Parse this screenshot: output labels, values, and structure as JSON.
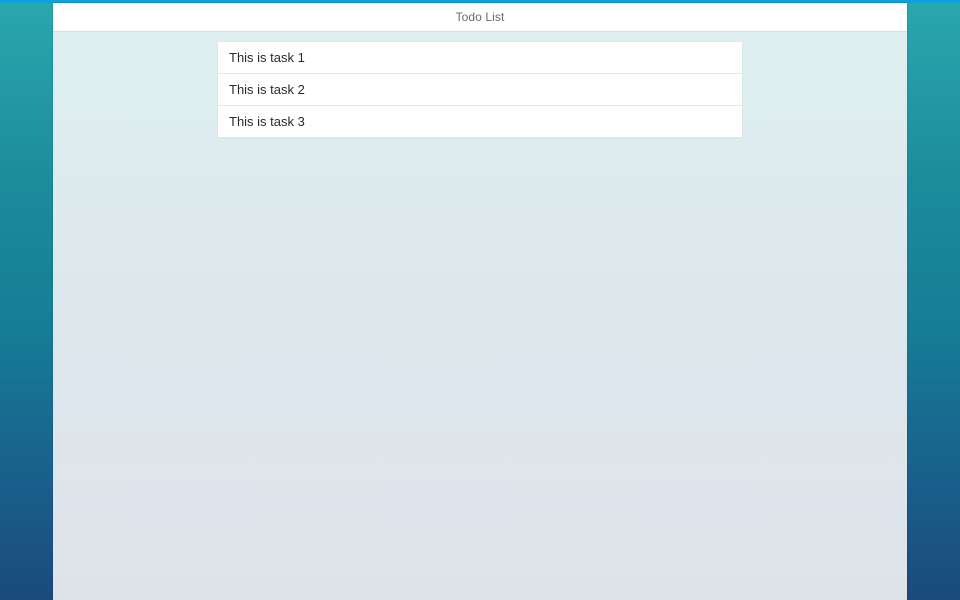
{
  "colors": {
    "accent_bar": "#0ea0d8",
    "desktop_top": "#2aa7ae",
    "desktop_bottom": "#1b4a7d",
    "panel_background": "#dfeaee",
    "header_background": "#ffffff",
    "task_background": "#ffffff"
  },
  "header": {
    "title": "Todo List"
  },
  "tasks": [
    {
      "label": "This is task 1"
    },
    {
      "label": "This is task 2"
    },
    {
      "label": "This is task 3"
    }
  ]
}
